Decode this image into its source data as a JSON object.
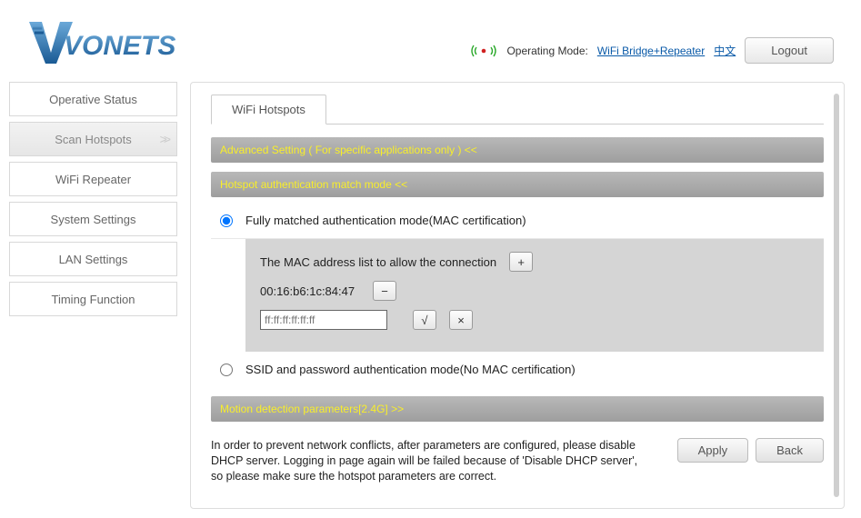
{
  "brand": "VONETS",
  "header": {
    "op_mode_label": "Operating Mode:",
    "op_mode_value": "WiFi Bridge+Repeater",
    "lang": "中文",
    "logout": "Logout"
  },
  "sidebar": {
    "items": [
      {
        "label": "Operative Status"
      },
      {
        "label": "Scan Hotspots"
      },
      {
        "label": "WiFi Repeater"
      },
      {
        "label": "System Settings"
      },
      {
        "label": "LAN Settings"
      },
      {
        "label": "Timing Function"
      }
    ]
  },
  "main": {
    "tab": "WiFi Hotspots",
    "section_advanced": "Advanced Setting ( For specific applications only ) <<",
    "section_auth": "Hotspot authentication match mode <<",
    "radio1": "Fully matched authentication mode(MAC certification)",
    "mac_list_label": "The MAC address list to allow the connection",
    "mac_value": "00:16:b6:1c:84:47",
    "mac_placeholder": "ff:ff:ff:ff:ff:ff",
    "radio2": "SSID and password authentication mode(No MAC certification)",
    "section_motion": "Motion detection parameters[2.4G] >>",
    "note": "In order to prevent network conflicts, after parameters are configured, please disable DHCP server. Logging in page again will be failed because of 'Disable DHCP server', so please make sure the hotspot parameters are correct.",
    "apply": "Apply",
    "back": "Back",
    "btn_plus": "+",
    "btn_minus": "−",
    "btn_check": "√",
    "btn_x": "×"
  }
}
